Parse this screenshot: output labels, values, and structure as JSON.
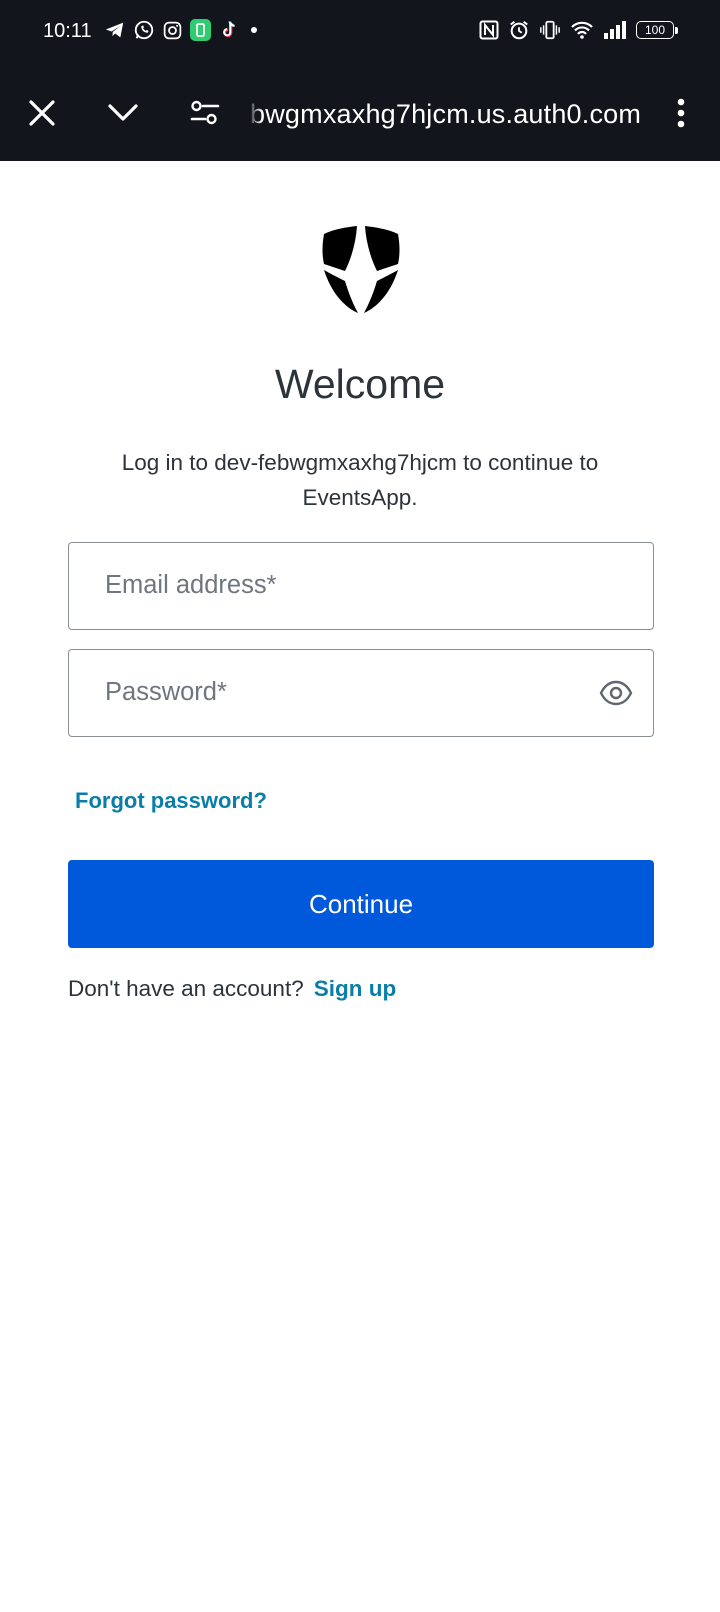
{
  "status_bar": {
    "time": "10:11",
    "battery": "100",
    "notification_icons": [
      "telegram-icon",
      "whatsapp-icon",
      "instagram-icon",
      "app-icon",
      "tiktok-icon",
      "dot-icon"
    ],
    "system_icons": [
      "nfc-icon",
      "alarm-icon",
      "vibrate-icon",
      "wifi-icon",
      "signal-icon",
      "battery-icon"
    ]
  },
  "browser": {
    "url": "bwgmxaxhg7hjcm.us.auth0.com",
    "icons": [
      "close-icon",
      "chevron-down-icon",
      "site-settings-icon",
      "more-vert-icon"
    ]
  },
  "login": {
    "title": "Welcome",
    "subtitle": "Log in to dev-febwgmxaxhg7hjcm to continue to EventsApp.",
    "email_placeholder": "Email address*",
    "password_placeholder": "Password*",
    "forgot_password": "Forgot password?",
    "continue_label": "Continue",
    "no_account_text": "Don't have an account?",
    "signup_label": "Sign up"
  },
  "colors": {
    "chrome_bg": "#13151c",
    "primary_button": "#0059db",
    "link": "#0a7ea8",
    "text": "#2d333a"
  }
}
